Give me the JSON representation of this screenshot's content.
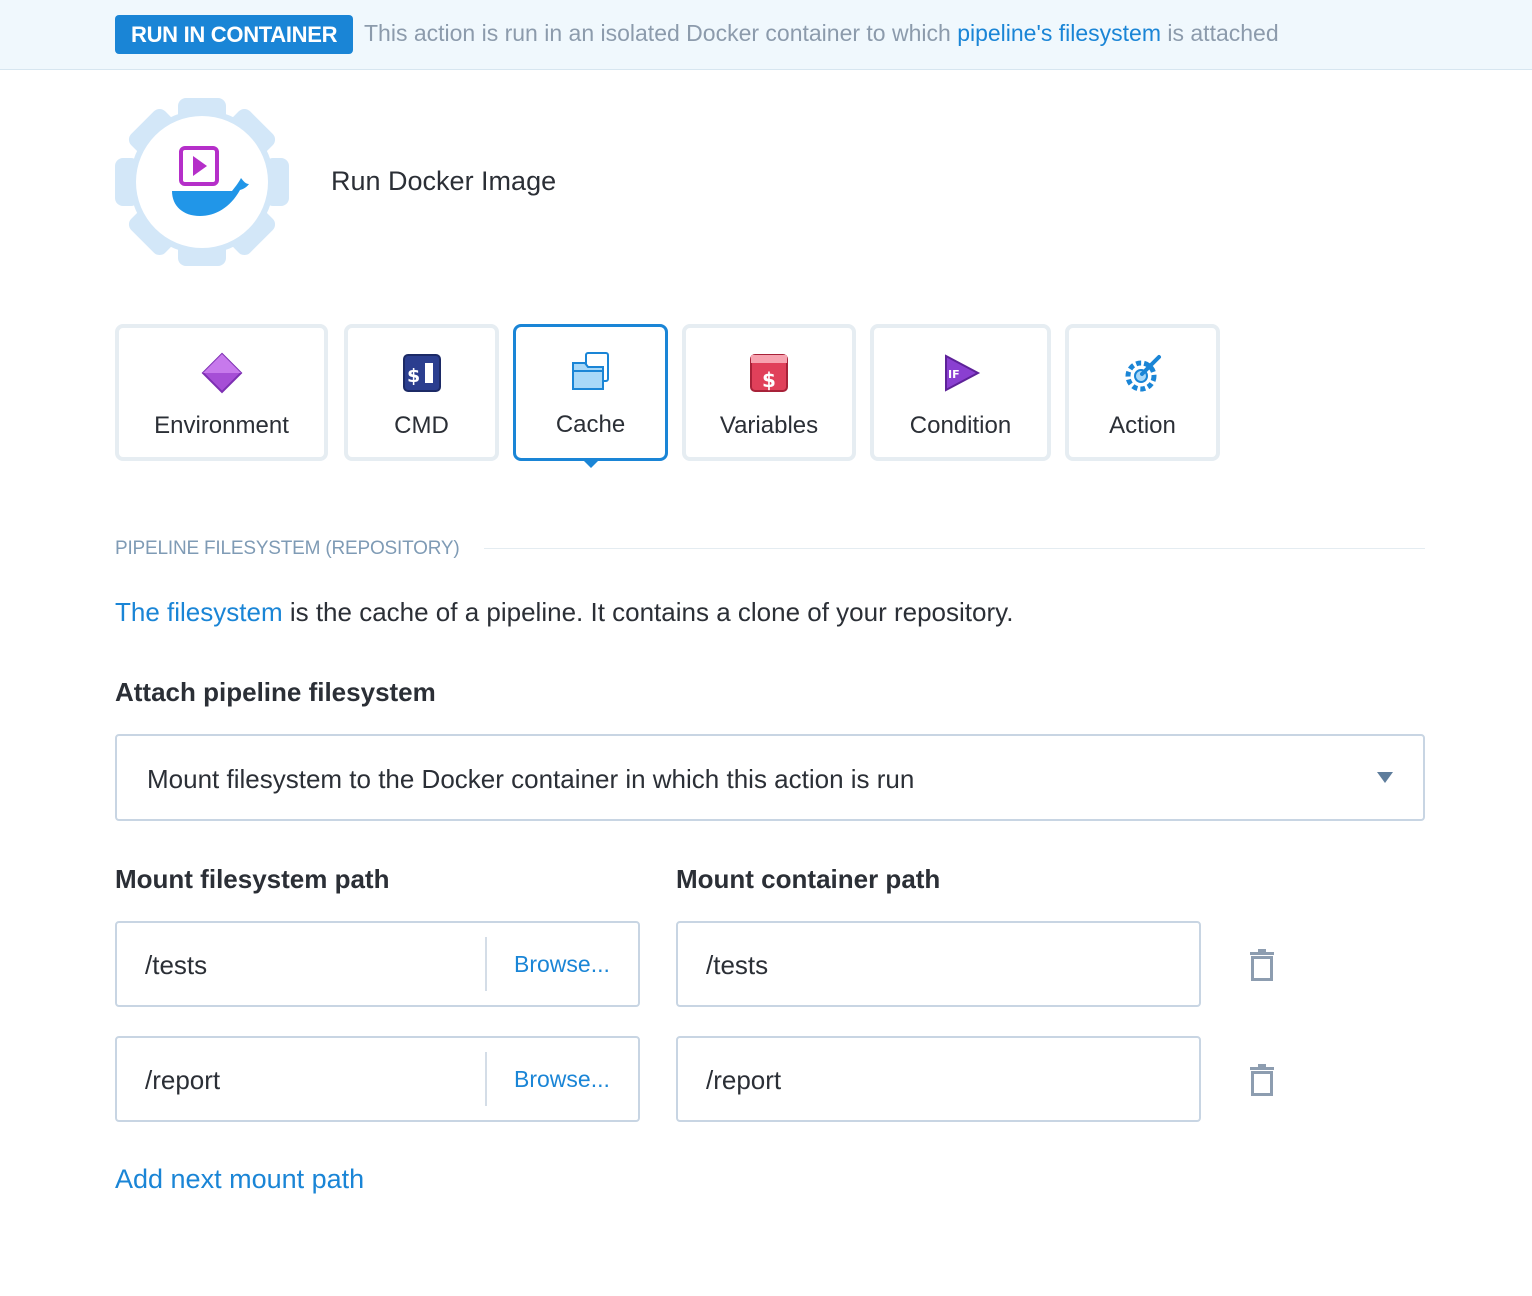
{
  "banner": {
    "badge": "RUN IN CONTAINER",
    "text_before": "This action is run in an isolated Docker container to which ",
    "text_link": "pipeline's filesystem",
    "text_after": " is attached"
  },
  "action": {
    "title": "Run Docker Image",
    "icon": "docker-whale-icon"
  },
  "tabs": [
    {
      "label": "Environment",
      "icon": "diamond-icon",
      "active": false
    },
    {
      "label": "CMD",
      "icon": "terminal-dollar-icon",
      "active": false
    },
    {
      "label": "Cache",
      "icon": "folder-files-icon",
      "active": true
    },
    {
      "label": "Variables",
      "icon": "dollar-window-icon",
      "active": false
    },
    {
      "label": "Condition",
      "icon": "if-play-icon",
      "active": false
    },
    {
      "label": "Action",
      "icon": "gear-wrench-icon",
      "active": false
    }
  ],
  "section": {
    "heading": "PIPELINE FILESYSTEM (REPOSITORY)",
    "desc_link": "The filesystem",
    "desc_text": " is the cache of a pipeline. It contains a clone of your repository."
  },
  "attach": {
    "label": "Attach pipeline filesystem",
    "selected": "Mount filesystem to the Docker container in which this action is run"
  },
  "mounts": {
    "fs_label": "Mount filesystem path",
    "container_label": "Mount container path",
    "browse_label": "Browse...",
    "rows": [
      {
        "fs_path": "/tests",
        "container_path": "/tests"
      },
      {
        "fs_path": "/report",
        "container_path": "/report"
      }
    ],
    "add_label": "Add next mount path"
  },
  "colors": {
    "accent": "#1a85d6",
    "banner_bg": "#f0f8fd",
    "border": "#c8d5e3"
  }
}
